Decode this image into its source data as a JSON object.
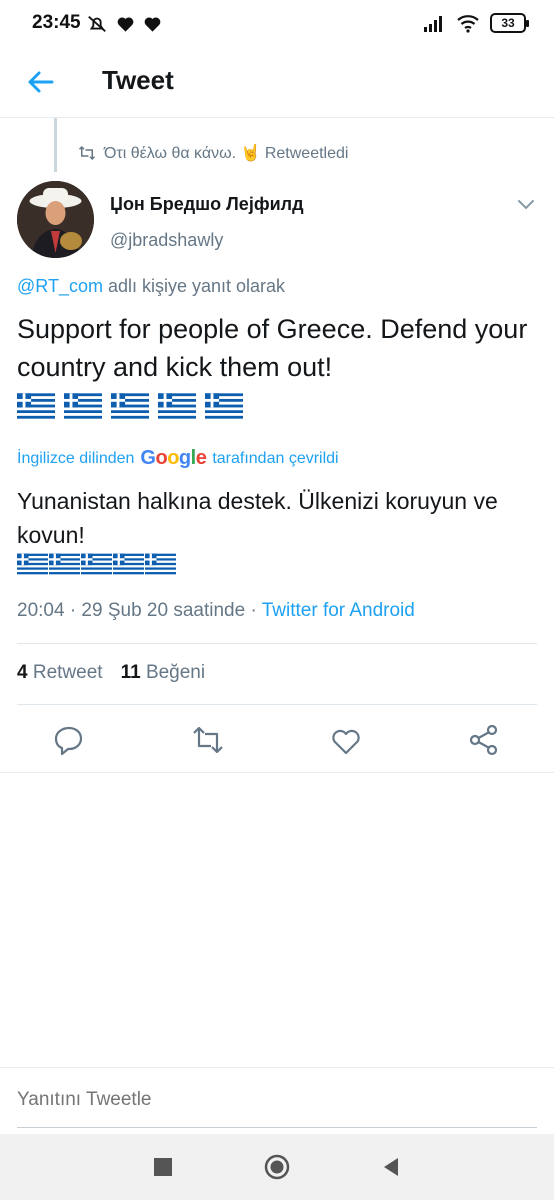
{
  "status_bar": {
    "time": "23:45",
    "battery": "33",
    "icons": [
      "silent-bell-icon",
      "heart-icon",
      "heart-icon",
      "signal-icon",
      "wifi-icon",
      "battery-icon"
    ]
  },
  "header": {
    "title": "Tweet",
    "back_icon": "arrow-left-icon"
  },
  "retweet_context": {
    "text": "Ότι θέλω θα κάνω. 🤘 Retweetledi"
  },
  "tweet": {
    "author_name": "Џон Бредшо Лејфилд",
    "author_handle": "@jbradshawly",
    "reply_mention": "@RT_com",
    "reply_suffix": " adlı kişiye yanıt olarak",
    "text": "Support for people of Greece. Defend your country and kick them out!",
    "flag_count": 5,
    "translation_prefix": "İngilizce dilinden",
    "translation_brand": "Google",
    "translation_suffix": "tarafından çevrildi",
    "translated_text": "Yunanistan halkına destek. Ülkenizi koruyun ve kovun!",
    "timestamp": "20:04 · 29 Şub 20 saatinde · ",
    "source": "Twitter for Android",
    "retweet_count": "4",
    "retweet_label": "Retweet",
    "like_count": "11",
    "like_label": "Beğeni"
  },
  "actions": [
    "reply-icon",
    "retweet-icon",
    "like-heart-icon",
    "share-icon"
  ],
  "compose": {
    "placeholder": "Yanıtını Tweetle"
  },
  "colors": {
    "accent": "#1da1f2",
    "muted": "#657786",
    "text": "#14171a",
    "greece_blue": "#0d5eaf"
  }
}
